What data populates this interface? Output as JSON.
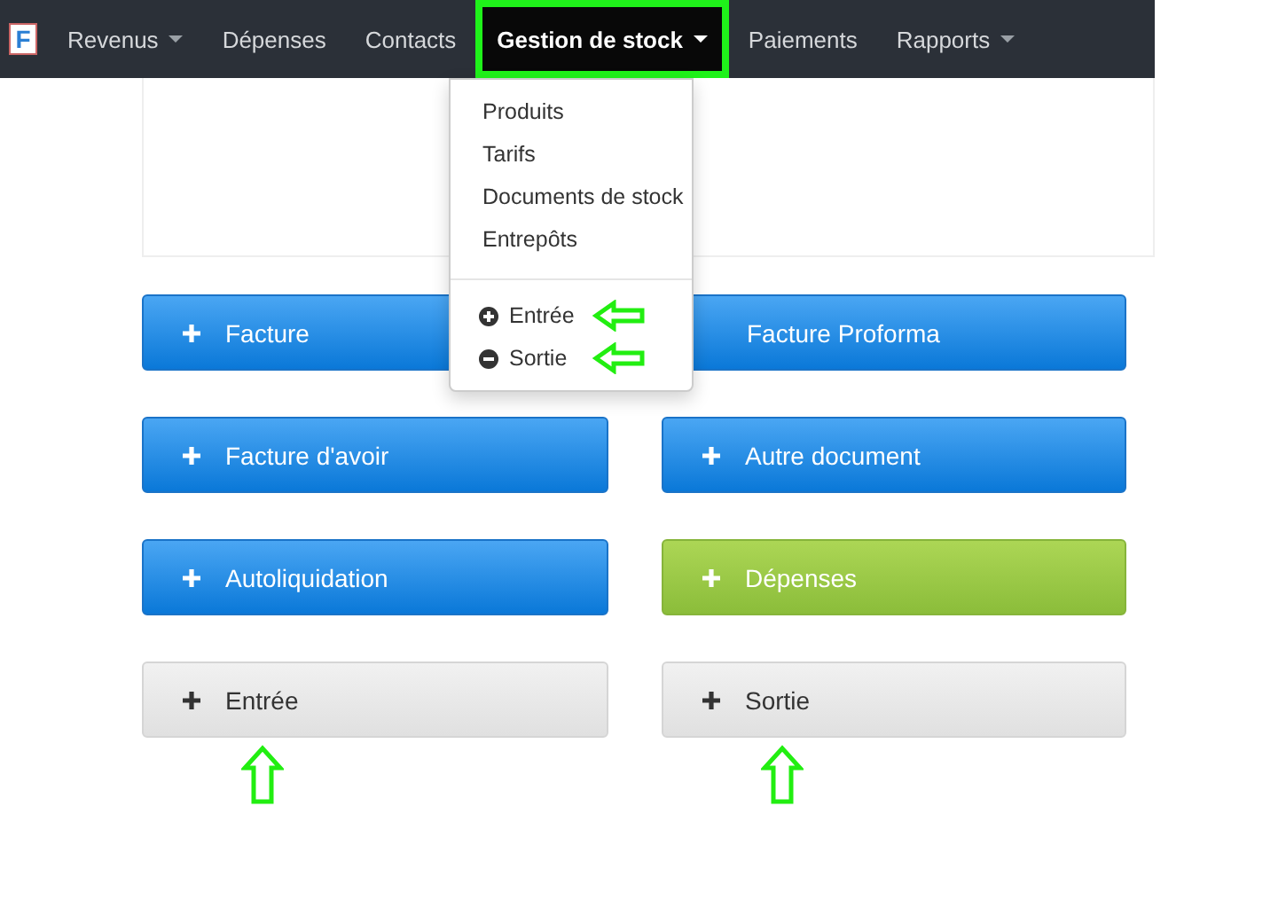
{
  "navbar": {
    "logo": "F",
    "items": [
      {
        "label": "Revenus",
        "caret": true,
        "selected": false,
        "highlighted": false
      },
      {
        "label": "Dépenses",
        "caret": false,
        "selected": false,
        "highlighted": false
      },
      {
        "label": "Contacts",
        "caret": false,
        "selected": false,
        "highlighted": false
      },
      {
        "label": "Gestion de stock",
        "caret": true,
        "selected": true,
        "highlighted": true
      },
      {
        "label": "Paiements",
        "caret": false,
        "selected": false,
        "highlighted": false
      },
      {
        "label": "Rapports",
        "caret": true,
        "selected": false,
        "highlighted": false
      }
    ]
  },
  "dropdown": {
    "items": [
      {
        "kind": "link",
        "label": "Produits",
        "annotated": false
      },
      {
        "kind": "link",
        "label": "Tarifs",
        "annotated": false
      },
      {
        "kind": "link",
        "label": "Documents de stock",
        "annotated": false
      },
      {
        "kind": "link",
        "label": "Entrepôts",
        "annotated": false
      },
      {
        "kind": "divider"
      },
      {
        "kind": "plus",
        "label": "Entrée",
        "annotated": true
      },
      {
        "kind": "minus",
        "label": "Sortie",
        "annotated": true
      }
    ]
  },
  "buttons": [
    {
      "kind": "primary",
      "label": "Facture",
      "icon": true,
      "annotated": false
    },
    {
      "kind": "primary",
      "label": "Facture Proforma",
      "icon": false,
      "annotated": false
    },
    {
      "kind": "primary",
      "label": "Facture d'avoir",
      "icon": true,
      "annotated": false
    },
    {
      "kind": "primary",
      "label": "Autre document",
      "icon": true,
      "annotated": false
    },
    {
      "kind": "primary",
      "label": "Autoliquidation",
      "icon": true,
      "annotated": false
    },
    {
      "kind": "success",
      "label": "Dépenses",
      "icon": true,
      "annotated": false
    },
    {
      "kind": "default",
      "label": "Entrée",
      "icon": true,
      "annotated": true
    },
    {
      "kind": "default",
      "label": "Sortie",
      "icon": true,
      "annotated": true
    }
  ]
}
